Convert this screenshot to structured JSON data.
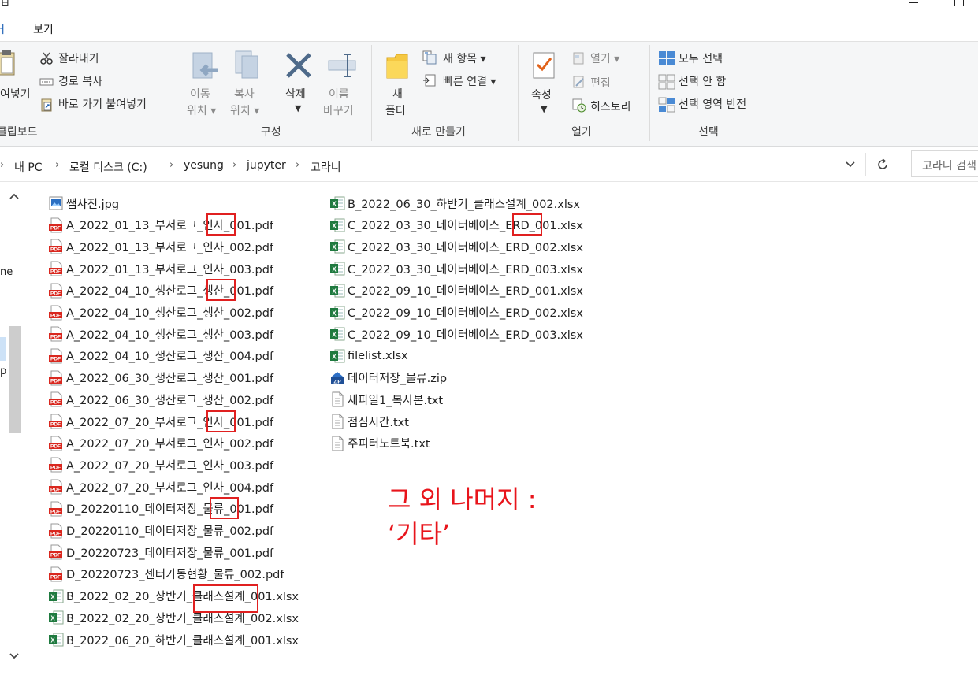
{
  "window": {
    "title_fragment": "ㅂ"
  },
  "menu": {
    "prev_tab": "ㅓ",
    "view_tab": "보기"
  },
  "ribbon": {
    "clipboard": {
      "paste_fragment": "여넣기",
      "cut": "잘라내기",
      "copy_path": "경로 복사",
      "paste_shortcut": "바로 가기 붙여넣기",
      "group_label": "클립보드"
    },
    "organize": {
      "move_line1": "이동",
      "move_line2": "위치",
      "copy_line1": "복사",
      "copy_line2": "위치",
      "delete": "삭제",
      "rename_line1": "이름",
      "rename_line2": "바꾸기",
      "group_label": "구성"
    },
    "new": {
      "folder_line1": "새",
      "folder_line2": "폴더",
      "new_item": "새 항목",
      "easy_access": "빠른 연결",
      "group_label": "새로 만들기"
    },
    "open": {
      "properties": "속성",
      "open": "열기",
      "edit": "편집",
      "history": "히스토리",
      "group_label": "열기"
    },
    "select": {
      "select_all": "모두 선택",
      "select_none": "선택 안 함",
      "invert": "선택 영역 반전",
      "group_label": "선택"
    }
  },
  "address": {
    "crumbs": [
      "내 PC",
      "로컬 디스크 (C:)",
      "yesung",
      "jupyter",
      "고라니"
    ],
    "search_placeholder": "고라니 검색"
  },
  "nav": {
    "frag1": "ne",
    "frag2": "p"
  },
  "files_col1": [
    {
      "name": "쌤사진.jpg",
      "type": "jpg"
    },
    {
      "name": "A_2022_01_13_부서로그_인사_001.pdf",
      "type": "pdf"
    },
    {
      "name": "A_2022_01_13_부서로그_인사_002.pdf",
      "type": "pdf"
    },
    {
      "name": "A_2022_01_13_부서로그_인사_003.pdf",
      "type": "pdf"
    },
    {
      "name": "A_2022_04_10_생산로그_생산_001.pdf",
      "type": "pdf"
    },
    {
      "name": "A_2022_04_10_생산로그_생산_002.pdf",
      "type": "pdf"
    },
    {
      "name": "A_2022_04_10_생산로그_생산_003.pdf",
      "type": "pdf"
    },
    {
      "name": "A_2022_04_10_생산로그_생산_004.pdf",
      "type": "pdf"
    },
    {
      "name": "A_2022_06_30_생산로그_생산_001.pdf",
      "type": "pdf"
    },
    {
      "name": "A_2022_06_30_생산로그_생산_002.pdf",
      "type": "pdf"
    },
    {
      "name": "A_2022_07_20_부서로그_인사_001.pdf",
      "type": "pdf"
    },
    {
      "name": "A_2022_07_20_부서로그_인사_002.pdf",
      "type": "pdf"
    },
    {
      "name": "A_2022_07_20_부서로그_인사_003.pdf",
      "type": "pdf"
    },
    {
      "name": "A_2022_07_20_부서로그_인사_004.pdf",
      "type": "pdf"
    },
    {
      "name": "D_20220110_데이터저장_물류_001.pdf",
      "type": "pdf"
    },
    {
      "name": "D_20220110_데이터저장_물류_002.pdf",
      "type": "pdf"
    },
    {
      "name": "D_20220723_데이터저장_물류_001.pdf",
      "type": "pdf"
    },
    {
      "name": "D_20220723_센터가동현황_물류_002.pdf",
      "type": "pdf"
    },
    {
      "name": "B_2022_02_20_상반기_클래스설계_001.xlsx",
      "type": "xlsx"
    },
    {
      "name": "B_2022_02_20_상반기_클래스설계_002.xlsx",
      "type": "xlsx"
    },
    {
      "name": "B_2022_06_20_하반기_클래스설계_001.xlsx",
      "type": "xlsx"
    }
  ],
  "files_col2": [
    {
      "name": "B_2022_06_30_하반기_클래스설계_002.xlsx",
      "type": "xlsx"
    },
    {
      "name": "C_2022_03_30_데이터베이스_ERD_001.xlsx",
      "type": "xlsx"
    },
    {
      "name": "C_2022_03_30_데이터베이스_ERD_002.xlsx",
      "type": "xlsx"
    },
    {
      "name": "C_2022_03_30_데이터베이스_ERD_003.xlsx",
      "type": "xlsx"
    },
    {
      "name": "C_2022_09_10_데이터베이스_ERD_001.xlsx",
      "type": "xlsx"
    },
    {
      "name": "C_2022_09_10_데이터베이스_ERD_002.xlsx",
      "type": "xlsx"
    },
    {
      "name": "C_2022_09_10_데이터베이스_ERD_003.xlsx",
      "type": "xlsx"
    },
    {
      "name": "filelist.xlsx",
      "type": "xlsx"
    },
    {
      "name": "데이터저장_물류.zip",
      "type": "zip"
    },
    {
      "name": "새파일1_복사본.txt",
      "type": "txt"
    },
    {
      "name": "점심시간.txt",
      "type": "txt"
    },
    {
      "name": "주피터노트북.txt",
      "type": "txt"
    }
  ],
  "annotation": {
    "line1": "그 외 나머지 :",
    "line2": "‘기타’"
  },
  "colors": {
    "highlight": "#e02020",
    "annotation": "#e8141b",
    "pdf": "#d9271e",
    "excel": "#1f7a3f"
  }
}
